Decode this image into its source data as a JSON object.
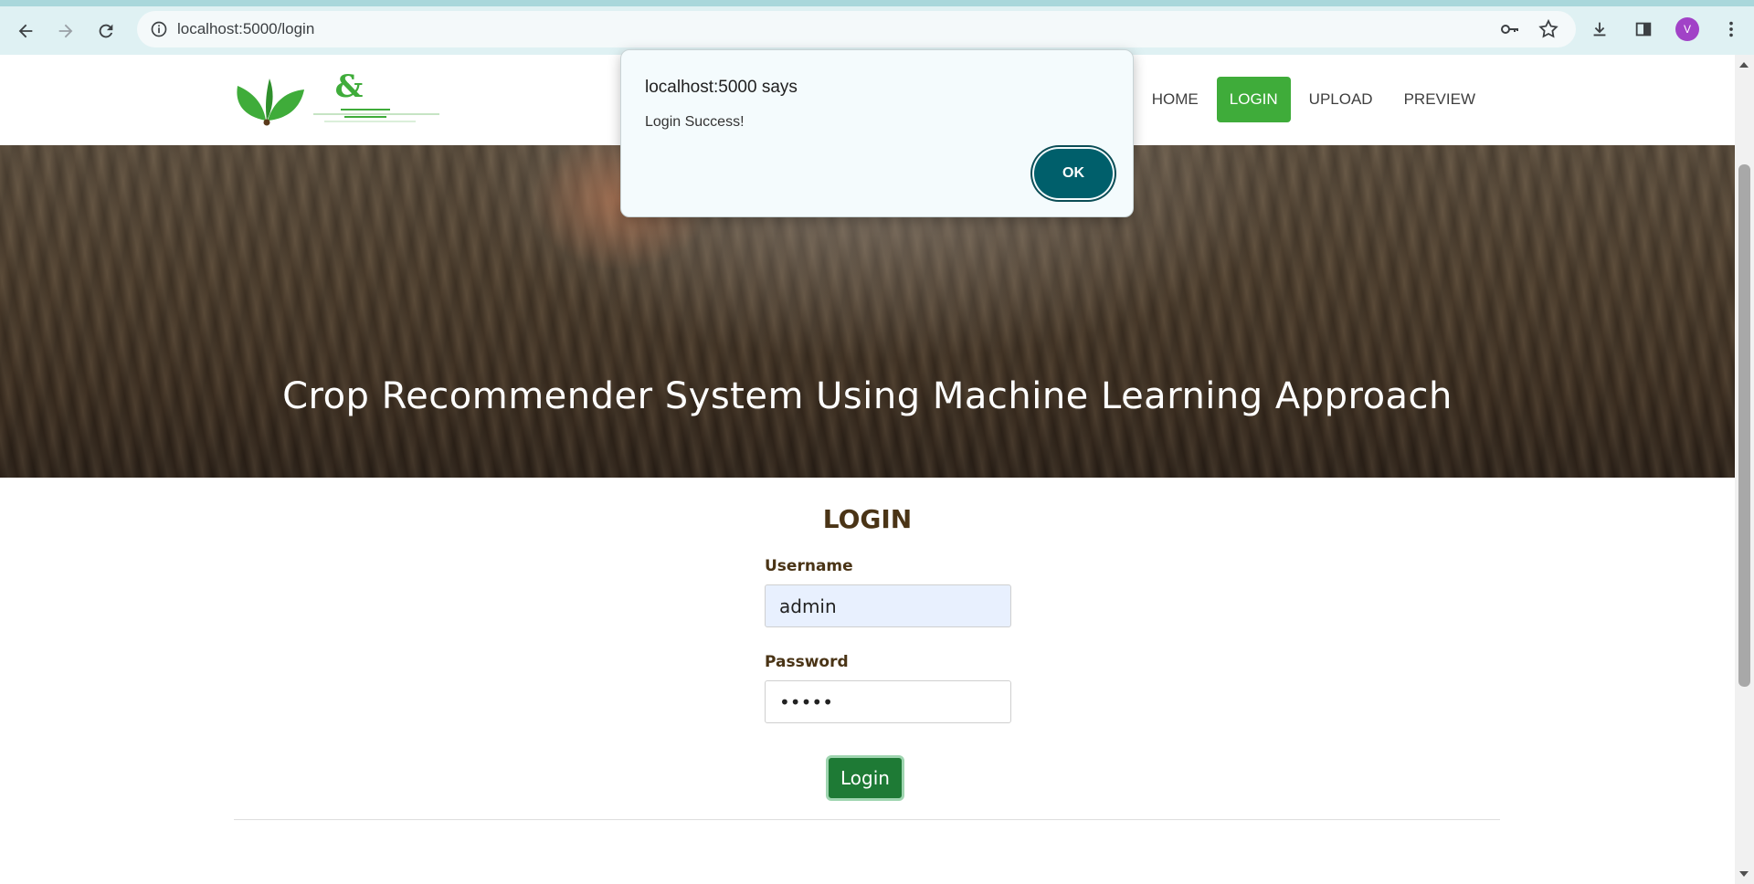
{
  "browser": {
    "url": "localhost:5000/login",
    "profile_initial": "V"
  },
  "site": {
    "logo_text": "&",
    "nav": [
      {
        "label": "HOME",
        "active": false
      },
      {
        "label": "LOGIN",
        "active": true
      },
      {
        "label": "UPLOAD",
        "active": false
      },
      {
        "label": "PREVIEW",
        "active": false
      }
    ],
    "hero_title": "Crop Recommender System Using Machine Learning Approach"
  },
  "login": {
    "heading": "LOGIN",
    "username_label": "Username",
    "username_value": "admin",
    "password_label": "Password",
    "password_value": "•••••",
    "button_label": "Login"
  },
  "dialog": {
    "title": "localhost:5000 says",
    "message": "Login Success!",
    "ok_label": "OK"
  },
  "colors": {
    "accent_green": "#3fac3a",
    "button_green": "#1e7a35",
    "heading_brown": "#4a3416",
    "dialog_button": "#005f6b"
  }
}
